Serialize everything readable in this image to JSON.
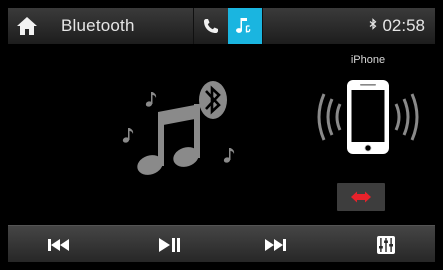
{
  "header": {
    "title": "Bluetooth",
    "time": "02:58",
    "active_tab": "music"
  },
  "device": {
    "name": "iPhone"
  },
  "icons": {
    "home": "home-icon",
    "phone": "phone-icon",
    "music": "music-note-icon",
    "bluetooth": "bluetooth-icon",
    "album_art": "bluetooth-music-icon",
    "phone_connected": "phone-vibrate-icon",
    "disconnect": "disconnect-icon",
    "previous": "skip-previous-icon",
    "play_pause": "play-pause-icon",
    "next": "skip-next-icon",
    "equalizer": "equalizer-icon"
  },
  "colors": {
    "accent": "#1ab5e0",
    "disconnect_red": "#e8222b",
    "icon_gray": "#8a8a8a"
  }
}
